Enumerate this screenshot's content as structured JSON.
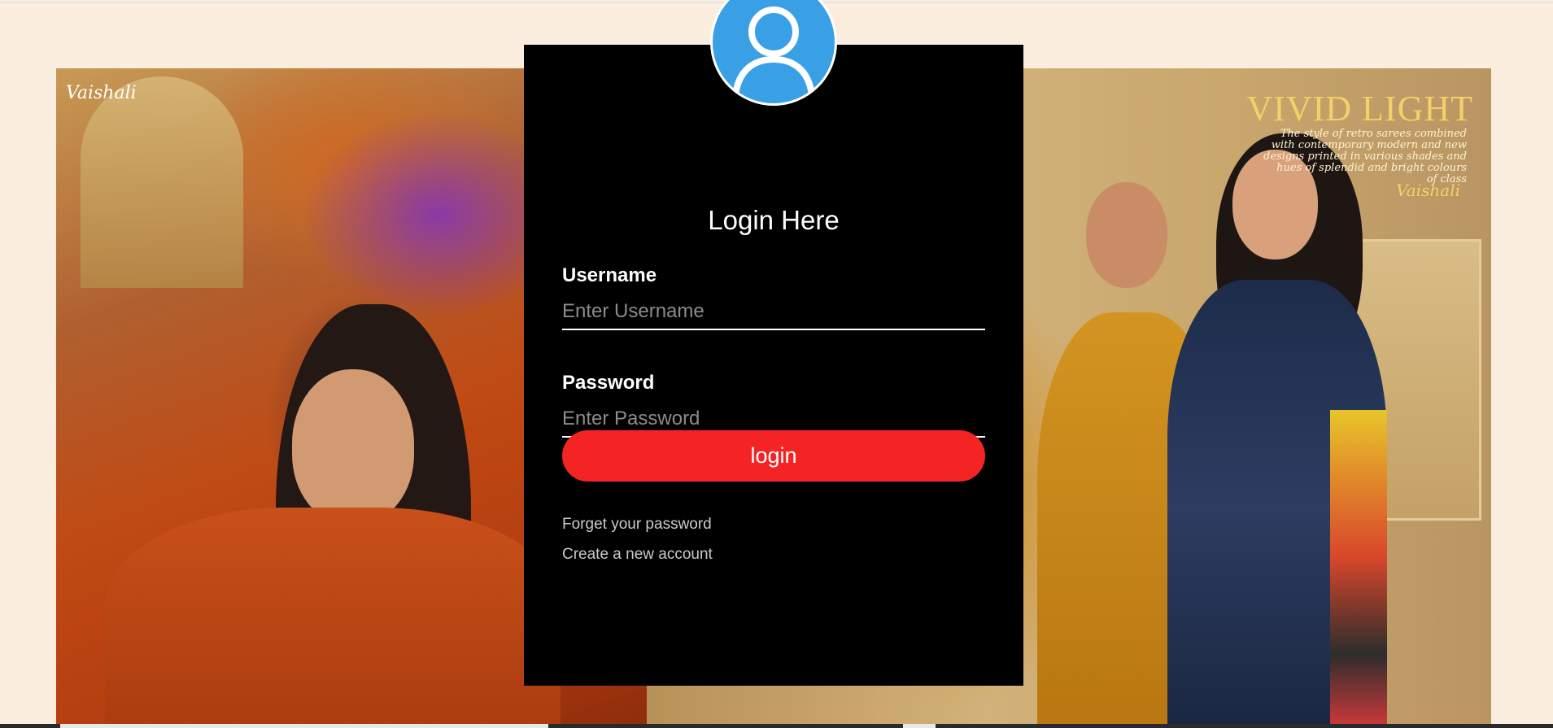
{
  "banner": {
    "brand_left": "Vaishali",
    "collection_title": "VIVID LIGHT",
    "collection_description": "The style of retro sarees combined with contemporary modern and new designs printed in various shades and hues of splendid and bright colours of class",
    "brand_right": "Vaishali"
  },
  "login": {
    "avatar_icon": "user-avatar-icon",
    "title": "Login Here",
    "username_label": "Username",
    "username_placeholder": "Enter Username",
    "username_value": "",
    "password_label": "Password",
    "password_placeholder": "Enter Password",
    "password_value": "",
    "submit_label": "login",
    "forgot_link": "Forget your password",
    "create_link": "Create a new account"
  },
  "colors": {
    "page_background": "#fbeedf",
    "card_background": "#000000",
    "button": "#f42424",
    "avatar": "#3aa0e6"
  }
}
